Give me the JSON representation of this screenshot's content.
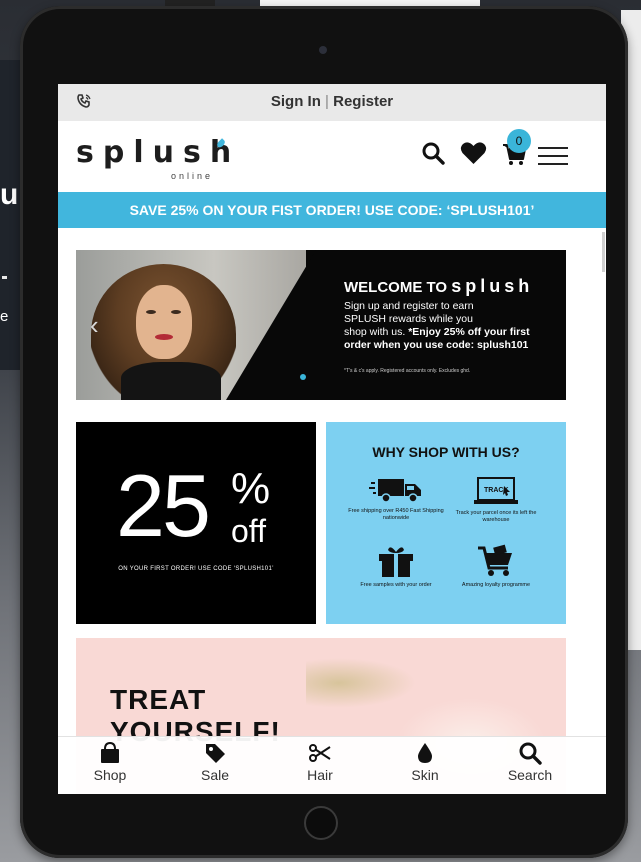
{
  "background": {
    "left_partial_text": "u",
    "left_partial_text_2": "e"
  },
  "topbar": {
    "sign_in": "Sign In",
    "separator": "|",
    "register": "Register"
  },
  "header": {
    "logo_text": "splush",
    "logo_subtext": "online",
    "cart_count": "0",
    "icons": [
      "search-icon",
      "heart-icon",
      "cart-icon",
      "menu-icon"
    ]
  },
  "promo_banner": {
    "text": "SAVE 25% ON YOUR FIST ORDER! USE CODE: ‘SPLUSH101’"
  },
  "hero": {
    "welcome_to": "WELCOME TO",
    "brand": "splush",
    "line1": "Sign up and register to earn",
    "line2": "SPLUSH rewards while you",
    "line3": "shop with us.",
    "bold_text": "*Enjoy 25% off your first order when you use code: splush101",
    "fine_print": "*T's & c's apply. Registered accounts only. Excludes ghd.",
    "prev_arrow": "‹"
  },
  "discount_tile": {
    "number": "25",
    "percent": "%",
    "off": "off",
    "code_line": "ON YOUR FIRST ORDER! USE CODE ‘SPLUSH101’"
  },
  "why_shop": {
    "heading": "WHY SHOP WITH US?",
    "features": [
      {
        "icon": "truck-icon",
        "text": "Free shipping over R450 Fast Shipping nationwide"
      },
      {
        "icon": "laptop-track-icon",
        "screen_text": "TRACK",
        "text": "Track your parcel once its left the warehouse"
      },
      {
        "icon": "gift-icon",
        "text": "Free samples with your order"
      },
      {
        "icon": "shopping-cart-icon",
        "text": "Amazing loyalty programme"
      }
    ]
  },
  "treat": {
    "title_line1": "TREAT",
    "title_line2": "YOURSELF!"
  },
  "bottom_nav": {
    "items": [
      {
        "label": "Shop",
        "icon": "shopping-bag-icon"
      },
      {
        "label": "Sale",
        "icon": "tag-icon"
      },
      {
        "label": "Hair",
        "icon": "scissors-icon"
      },
      {
        "label": "Skin",
        "icon": "drop-icon"
      },
      {
        "label": "Search",
        "icon": "search-icon"
      }
    ]
  },
  "colors": {
    "accent": "#41b6dd",
    "topbar_bg": "#e9e9e9",
    "tile_blue": "#7dd0f1",
    "treat_pink": "#f9d9d5"
  }
}
